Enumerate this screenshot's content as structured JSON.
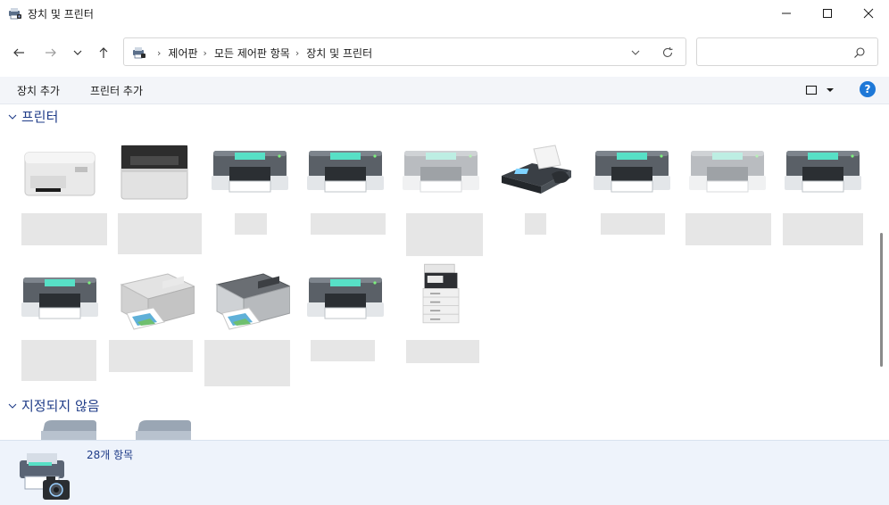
{
  "window": {
    "title": "장치 및 프린터"
  },
  "address": {
    "crumbs": [
      "제어판",
      "모든 제어판 항목",
      "장치 및 프린터"
    ]
  },
  "search": {
    "placeholder": "",
    "value": ""
  },
  "commands": {
    "add_device": "장치 추가",
    "add_printer": "프린터 추가"
  },
  "groups": {
    "printers": "프린터",
    "unspecified": "지정되지 않음"
  },
  "details": {
    "item_count": "28개 항목"
  },
  "icons": {
    "app": "devices-printers-icon",
    "back": "back-arrow-icon",
    "forward": "forward-arrow-icon",
    "recent": "chevron-down-icon",
    "up": "up-arrow-icon",
    "refresh": "refresh-icon",
    "search": "search-icon",
    "help": "help-icon"
  },
  "colors": {
    "group_header": "#1f3c88",
    "command_bar": "#f3f5f9",
    "details_bg": "#eef3fb",
    "help_blue": "#1e78d7"
  }
}
